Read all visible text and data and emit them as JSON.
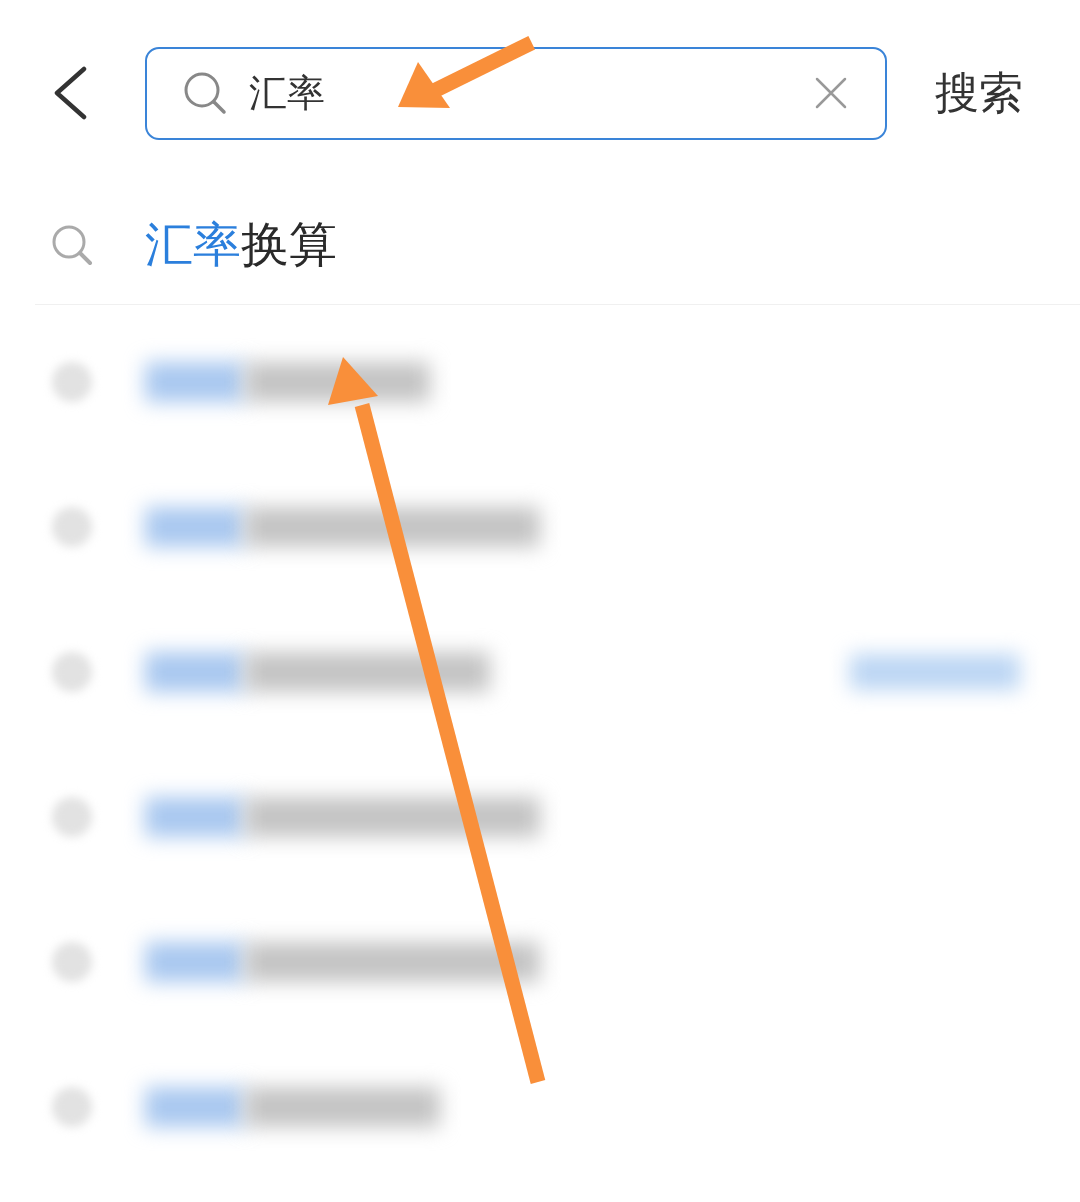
{
  "search": {
    "value": "汇率",
    "button": "搜索"
  },
  "suggestions": [
    {
      "match": "汇率",
      "rest": "换算"
    }
  ]
}
